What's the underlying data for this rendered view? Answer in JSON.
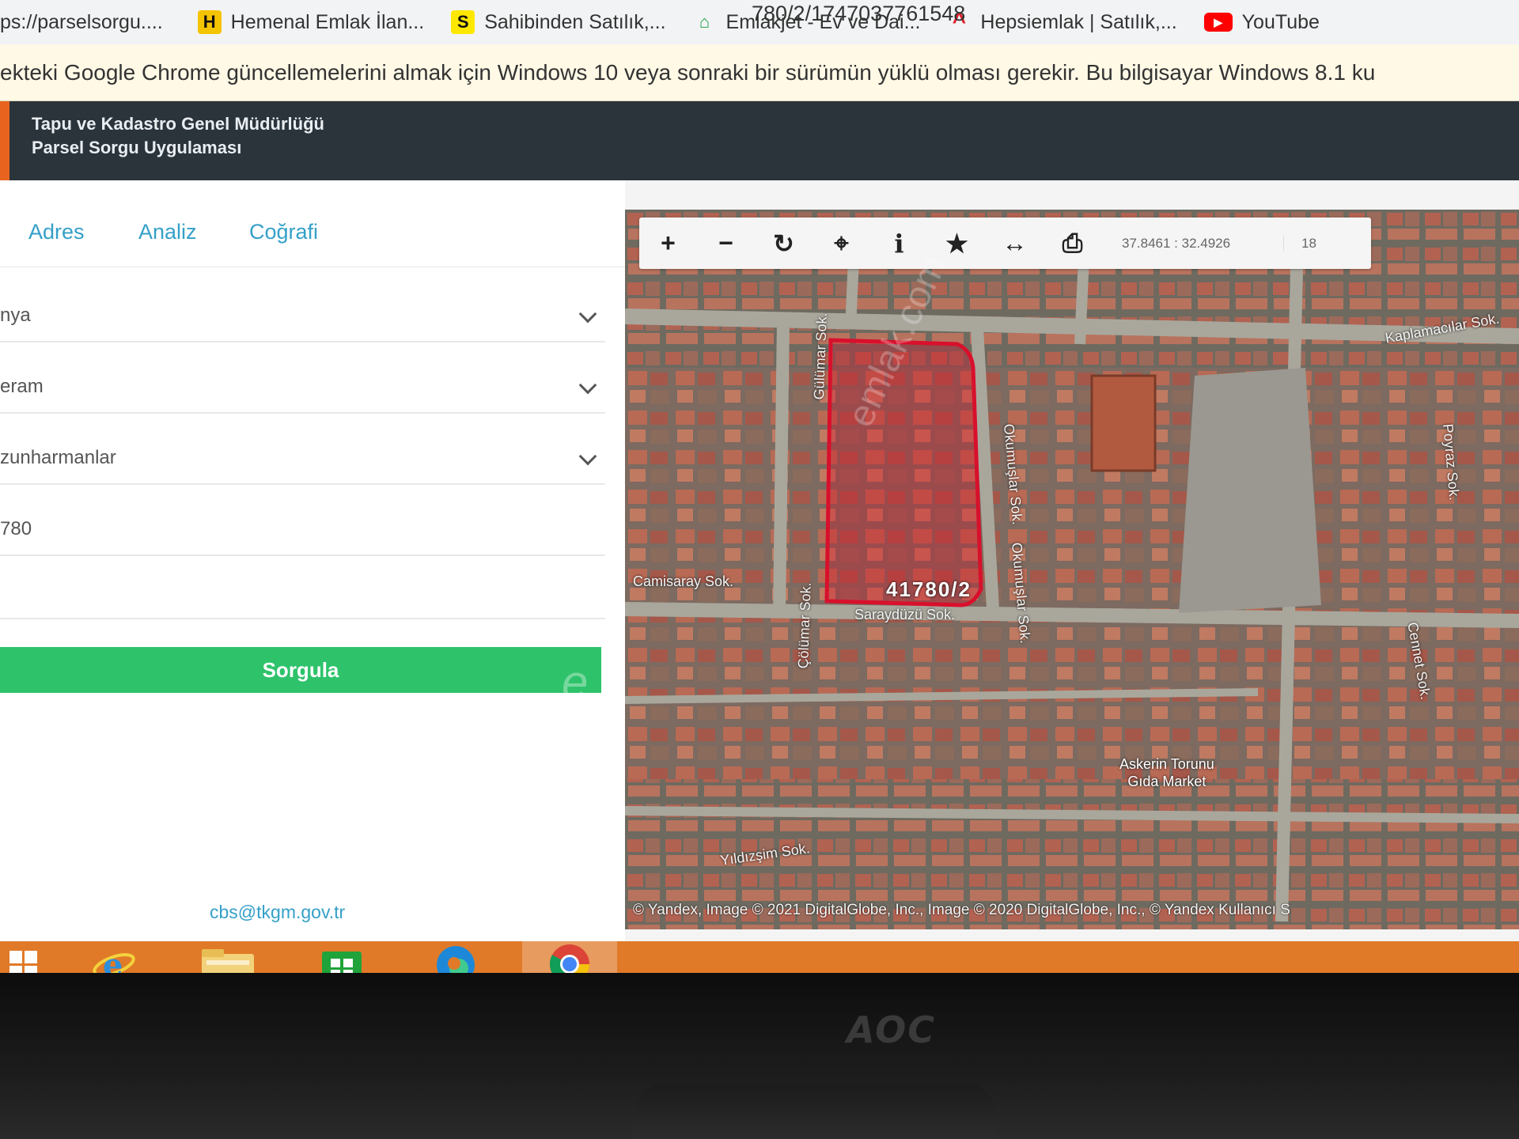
{
  "browser": {
    "url_fragment": "780/2/1747037761548",
    "bookmarks": [
      {
        "label": "ps://parselsorgu....",
        "icon": "globe-icon",
        "icon_text": ""
      },
      {
        "label": "Hemenal Emlak İlan...",
        "icon": "hemenal-logo-icon",
        "icon_text": "H"
      },
      {
        "label": "Sahibinden Satılık,...",
        "icon": "sahibinden-logo-icon",
        "icon_text": "S"
      },
      {
        "label": "Emlakjet - Ev ve Dai...",
        "icon": "emlakjet-logo-icon",
        "icon_text": "⌂"
      },
      {
        "label": "Hepsiemlak | Satılık,...",
        "icon": "hepsiemlak-logo-icon",
        "icon_text": "^"
      },
      {
        "label": "YouTube",
        "icon": "youtube-icon",
        "icon_text": "▶"
      }
    ],
    "infobar_text": "ekteki Google Chrome güncellemelerini almak için Windows 10 veya sonraki bir sürümün yüklü olması gerekir. Bu bilgisayar Windows 8.1 ku"
  },
  "app": {
    "title": "Tapu ve Kadastro Genel Müdürlüğü",
    "subtitle": "Parsel Sorgu Uygulaması"
  },
  "left_panel": {
    "tabs": [
      "Adres",
      "Analiz",
      "Coğrafi"
    ],
    "fields": {
      "province": "nya",
      "district": "eram",
      "neighborhood": "zunharmanlar",
      "block": "780",
      "parcel": ""
    },
    "query_button": "Sorgula",
    "watermark": "e",
    "contact": "cbs@tkgm.gov.tr"
  },
  "map": {
    "coordinates": "37.8461 : 32.4926",
    "zoom": "18",
    "parcel_label": "41780/2",
    "streets": {
      "s1": "Gülümar Sok.",
      "s2": "Okumuşlar Sok.",
      "s3": "Okumuşlar Sok.",
      "s4": "Camisaray Sok.",
      "s5": "Çölümar Sok.",
      "s6": "Saraydüzü Sok.",
      "s7": "Yıldızşim Sok.",
      "s8": "Kaplamacılar Sok.",
      "s9": "Poyraz Sok.",
      "s10": "Cennet Sok."
    },
    "poi": "Askerin Torunu\nGıda Market",
    "attribution": "© Yandex, Image © 2021 DigitalGlobe, Inc., Image © 2020 DigitalGlobe, Inc., © Yandex Kullanıcı S",
    "watermark": "emlak.com"
  },
  "colors": {
    "header_bg": "#2b333b",
    "accent_orange": "#e8641e",
    "tab_blue": "#35a0c8",
    "button_green": "#2ec36b",
    "parcel_red": "#d8102c",
    "taskbar": "#e07a28"
  },
  "taskbar": [
    "windows-start-icon",
    "internet-explorer-icon",
    "file-explorer-icon",
    "windows-store-icon",
    "edge-icon",
    "chrome-icon"
  ],
  "monitor_brand": "AOC"
}
